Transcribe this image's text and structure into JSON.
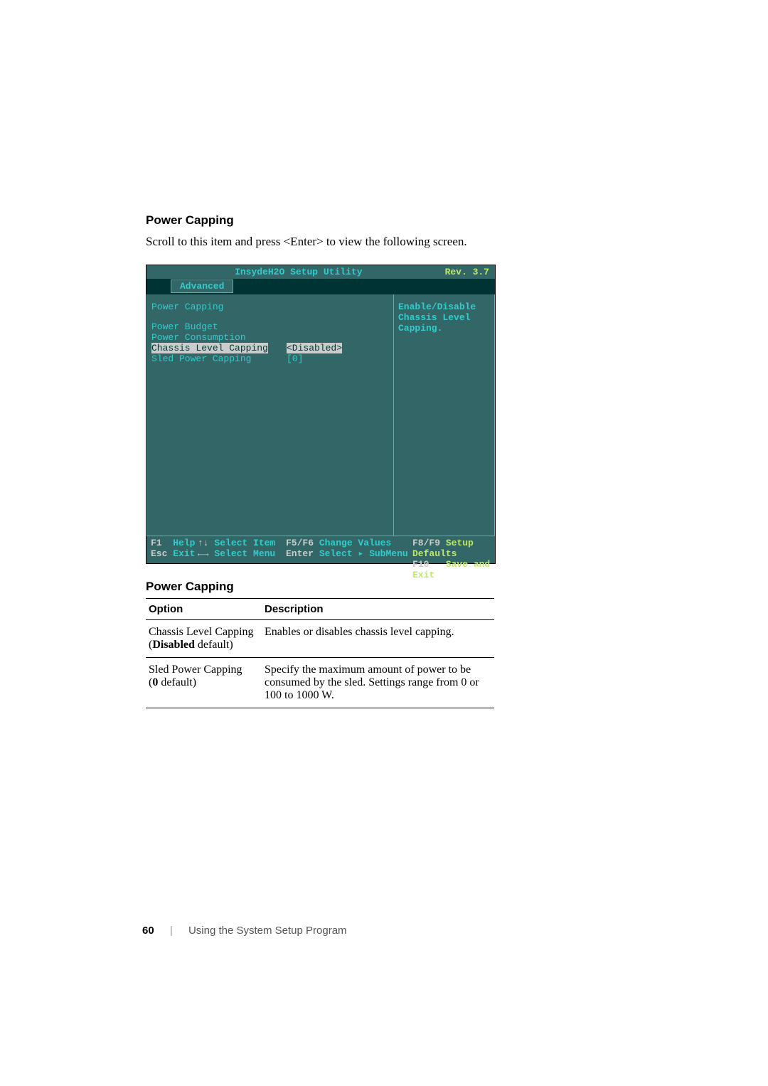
{
  "section": {
    "heading": "Power Capping",
    "intro": "Scroll to this item and press <Enter> to view the following screen."
  },
  "bios": {
    "title": "InsydeH2O Setup Utility",
    "revision": "Rev. 3.7",
    "tab": "Advanced",
    "screen_title": "Power Capping",
    "items": [
      {
        "label": "Power Budget",
        "value": ""
      },
      {
        "label": "Power Consumption",
        "value": ""
      },
      {
        "label": "Chassis Level Capping",
        "value": "<Disabled>",
        "selected": true
      },
      {
        "label": "Sled Power Capping",
        "value": "[0]"
      }
    ],
    "help_text": "Enable/Disable Chassis Level Capping.",
    "footer": {
      "f1": "F1",
      "help": "Help",
      "esc": "Esc",
      "exit": "Exit",
      "updown": "↑↓",
      "select_item": "Select Item",
      "leftright": "←→",
      "select_menu": "Select Menu",
      "f5f6": "F5/F6",
      "change_values": "Change Values",
      "enter": "Enter",
      "select_submenu": "Select ▸ SubMenu",
      "f8f9": "F8/F9",
      "setup_defaults": "Setup Defaults",
      "f10": "F10",
      "save_and_exit": "Save and Exit"
    }
  },
  "table": {
    "title": "Power Capping",
    "headers": {
      "option": "Option",
      "description": "Description"
    },
    "rows": [
      {
        "option_name": "Chassis Level Capping",
        "option_default_bold": "Disabled",
        "option_default_suffix": " default)",
        "description": "Enables or disables chassis level capping."
      },
      {
        "option_name": "Sled Power Capping",
        "option_default_bold": "0",
        "option_default_suffix": " default)",
        "description": "Specify the maximum amount of power to be consumed by the sled. Settings range from 0 or 100 to 1000 W."
      }
    ]
  },
  "footer": {
    "page_number": "60",
    "chapter": "Using the System Setup Program"
  }
}
